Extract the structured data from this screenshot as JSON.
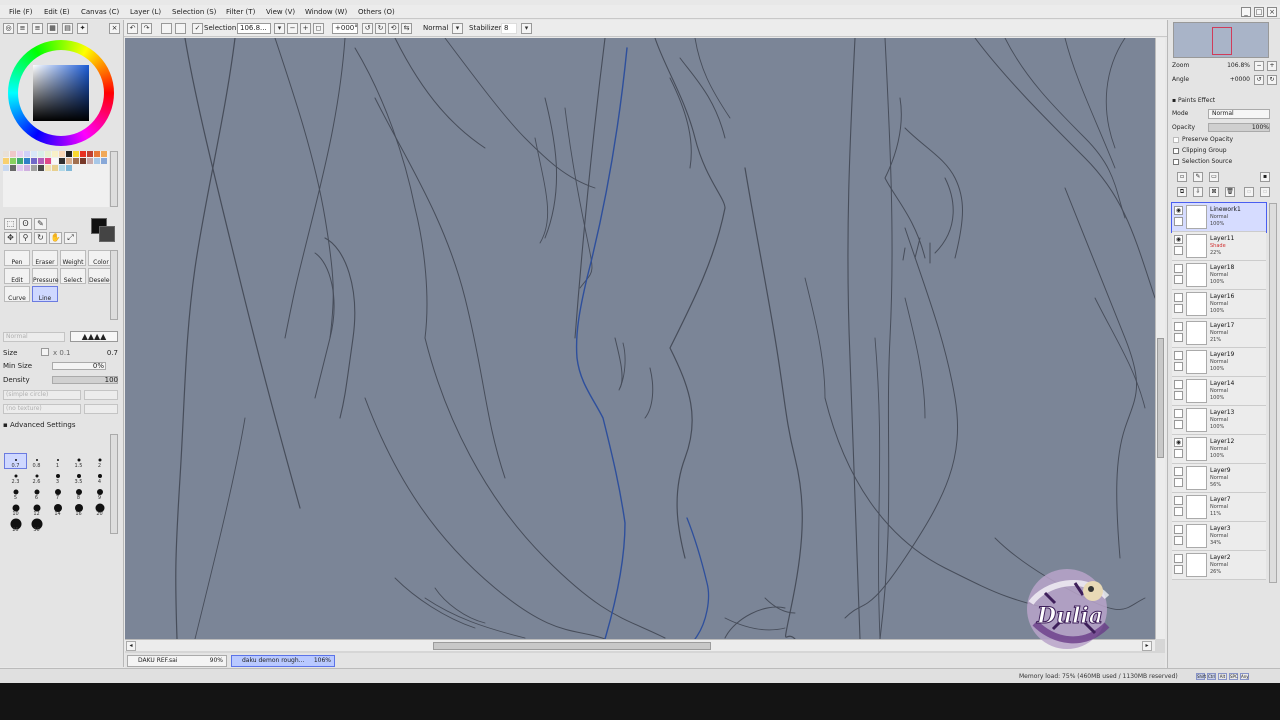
{
  "menu": {
    "items": [
      "File (F)",
      "Edit (E)",
      "Canvas (C)",
      "Layer (L)",
      "Selection (S)",
      "Filter (T)",
      "View (V)",
      "Window (W)",
      "Others (O)"
    ]
  },
  "toolbar": {
    "selection_label": "Selection",
    "zoom_value": "106.8...",
    "rotation_value": "+000°",
    "blend_mode": "Normal",
    "stabilizer_label": "Stabilizer",
    "stabilizer_value": "8"
  },
  "tool_panel": {
    "tool_labels": [
      "Pen",
      "Eraser",
      "Weight",
      "Color",
      "Edit",
      "Pressure",
      "Select",
      "Deselect",
      "Curve",
      "Line"
    ],
    "mode_value": "Normal",
    "size_label": "Size",
    "size_multiplier": "x 0.1",
    "size_value": "0.7",
    "min_size_label": "Min Size",
    "min_size_value": "0%",
    "density_label": "Density",
    "density_value": "100",
    "texture_1": "(simple circle)",
    "texture_2": "(no texture)",
    "advanced_label": "Advanced Settings",
    "brush_sizes": [
      "0.7",
      "0.8",
      "1",
      "1.5",
      "2",
      "2.3",
      "2.6",
      "3",
      "3.5",
      "4",
      "5",
      "6",
      "7",
      "8",
      "9",
      "10",
      "12",
      "14",
      "16",
      "20",
      "25",
      "30"
    ],
    "selected_brush_size": "0.7"
  },
  "colors": {
    "swatches": [
      "#e8e0d8",
      "#f0c8c8",
      "#e8d0f0",
      "#d0d0f8",
      "#d8e8f8",
      "#d8f0e8",
      "#e8f0d0",
      "#f8f0c8",
      "#f8d8b8",
      "#222222",
      "#f8d830",
      "#e83020",
      "#c04030",
      "#e87838",
      "#f0a858",
      "#f8d070",
      "#88d060",
      "#40a870",
      "#3080c8",
      "#7068c8",
      "#b060b8",
      "#e04888",
      "#f8f8f8",
      "#303030",
      "#d8b090",
      "#a07050",
      "#783828",
      "#c8a8a8",
      "#a8c8e8",
      "#88a8d8",
      "#c8d8f0",
      "#686868",
      "#e0c8f0",
      "#d0b0e0",
      "#a0a0a0",
      "#484848",
      "#f0e0b0",
      "#e8d090",
      "#b0d8e8",
      "#80b8d8"
    ],
    "foreground": "#111111",
    "background": "#444444"
  },
  "canvas": {
    "paper_color": "#7b8597",
    "sketch_color": "#474d5a",
    "lineart_color": "#2e4f9c"
  },
  "doc_tabs": [
    {
      "name": "DAKU REF.sai",
      "zoom": "90%",
      "active": false
    },
    {
      "name": "daku demon rough...",
      "zoom": "106%",
      "active": true
    }
  ],
  "status": {
    "memory": "Memory load: 75% (460MB used / 1130MB reserved)",
    "indicators": [
      "Shift",
      "Ctrl",
      "Alt",
      "SPC",
      "Any"
    ]
  },
  "navigator": {
    "zoom_label": "Zoom",
    "zoom_value": "106.8%",
    "angle_label": "Angle",
    "angle_value": "+0000"
  },
  "layer_panel": {
    "paints_effect_label": "Paints Effect",
    "mode_label": "Mode",
    "mode_value": "Normal",
    "opacity_label": "Opacity",
    "opacity_value": "100%",
    "preserve_opacity": "Preserve Opacity",
    "clipping_group": "Clipping Group",
    "selection_source": "Selection Source",
    "layers": [
      {
        "name": "Linework1",
        "mode": "Normal",
        "opacity": "100%",
        "selected": true,
        "visible": true
      },
      {
        "name": "Layer11",
        "mode": "Shade",
        "opacity": "22%",
        "selected": false,
        "visible": true
      },
      {
        "name": "Layer18",
        "mode": "Normal",
        "opacity": "100%",
        "selected": false,
        "visible": false
      },
      {
        "name": "Layer16",
        "mode": "Normal",
        "opacity": "100%",
        "selected": false,
        "visible": false
      },
      {
        "name": "Layer17",
        "mode": "Normal",
        "opacity": "21%",
        "selected": false,
        "visible": false
      },
      {
        "name": "Layer19",
        "mode": "Normal",
        "opacity": "100%",
        "selected": false,
        "visible": false
      },
      {
        "name": "Layer14",
        "mode": "Normal",
        "opacity": "100%",
        "selected": false,
        "visible": false
      },
      {
        "name": "Layer13",
        "mode": "Normal",
        "opacity": "100%",
        "selected": false,
        "visible": false
      },
      {
        "name": "Layer12",
        "mode": "Normal",
        "opacity": "100%",
        "selected": false,
        "visible": true
      },
      {
        "name": "Layer9",
        "mode": "Normal",
        "opacity": "56%",
        "selected": false,
        "visible": false
      },
      {
        "name": "Layer7",
        "mode": "Normal",
        "opacity": "11%",
        "selected": false,
        "visible": false
      },
      {
        "name": "Layer3",
        "mode": "Normal",
        "opacity": "34%",
        "selected": false,
        "visible": false
      },
      {
        "name": "Layer2",
        "mode": "Normal",
        "opacity": "26%",
        "selected": false,
        "visible": false
      }
    ]
  },
  "watermark": {
    "text": "Dulia"
  }
}
